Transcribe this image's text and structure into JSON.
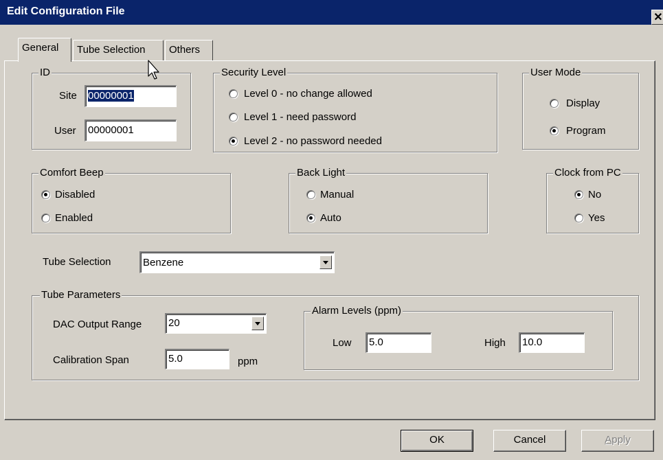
{
  "window": {
    "title": "Edit Configuration File",
    "close_glyph": "✕"
  },
  "tabs": [
    {
      "label": "General"
    },
    {
      "label": "Tube Selection"
    },
    {
      "label": "Others"
    }
  ],
  "id_group": {
    "legend": "ID",
    "site_label": "Site",
    "site_value": "00000001",
    "user_label": "User",
    "user_value": "00000001"
  },
  "security_level": {
    "legend": "Security Level",
    "options": [
      {
        "label": "Level 0 - no change allowed",
        "selected": false
      },
      {
        "label": "Level 1 - need password",
        "selected": false
      },
      {
        "label": "Level 2 - no password needed",
        "selected": true
      }
    ]
  },
  "user_mode": {
    "legend": "User Mode",
    "options": [
      {
        "label": "Display",
        "selected": false
      },
      {
        "label": "Program",
        "selected": true
      }
    ]
  },
  "comfort_beep": {
    "legend": "Comfort Beep",
    "options": [
      {
        "label": "Disabled",
        "selected": true
      },
      {
        "label": "Enabled",
        "selected": false
      }
    ]
  },
  "back_light": {
    "legend": "Back Light",
    "options": [
      {
        "label": "Manual",
        "selected": false
      },
      {
        "label": "Auto",
        "selected": true
      }
    ]
  },
  "clock_from_pc": {
    "legend": "Clock from PC",
    "options": [
      {
        "label": "No",
        "selected": true
      },
      {
        "label": "Yes",
        "selected": false
      }
    ]
  },
  "tube_selection": {
    "label": "Tube Selection",
    "value": "Benzene"
  },
  "tube_parameters": {
    "legend": "Tube Parameters",
    "dac_label": "DAC Output Range",
    "dac_value": "20",
    "cal_label": "Calibration Span",
    "cal_value": "5.0",
    "cal_unit": "ppm",
    "alarm": {
      "legend": "Alarm Levels (ppm)",
      "low_label": "Low",
      "low_value": "5.0",
      "high_label": "High",
      "high_value": "10.0"
    }
  },
  "buttons": {
    "ok": "OK",
    "cancel": "Cancel",
    "apply_first": "A",
    "apply_rest": "pply"
  },
  "colors": {
    "titlebar": "#0a246a",
    "face": "#d4d0c8",
    "selection": "#0a246a"
  }
}
